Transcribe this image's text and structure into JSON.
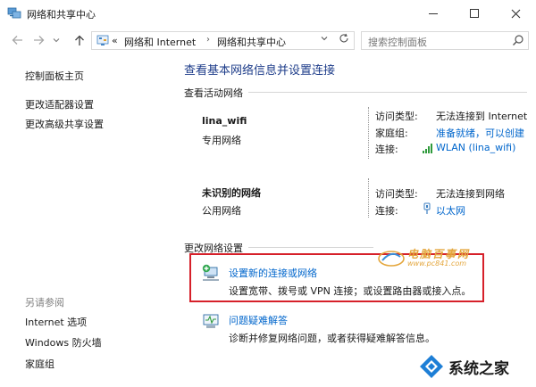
{
  "window": {
    "title": "网络和共享中心"
  },
  "address_bar": {
    "overflow": "«",
    "crumbs": [
      "网络和 Internet",
      "网络和共享中心"
    ],
    "chevron": "›"
  },
  "search": {
    "placeholder": "搜索控制面板"
  },
  "sidebar": {
    "links": [
      "控制面板主页",
      "更改适配器设置",
      "更改高级共享设置"
    ],
    "see_also_header": "另请参阅",
    "see_also": [
      "Internet 选项",
      "Windows 防火墙",
      "家庭组"
    ]
  },
  "main": {
    "title": "查看基本网络信息并设置连接",
    "active_networks_label": "查看活动网络",
    "networks": [
      {
        "name": "lina_wifi",
        "type": "专用网络",
        "rows": [
          {
            "key": "访问类型:",
            "value": "无法连接到 Internet",
            "link": false
          },
          {
            "key": "家庭组:",
            "value": "准备就绪，可以创建",
            "link": true
          },
          {
            "key": "连接:",
            "value": "WLAN (lina_wifi)",
            "link": true,
            "icon": "wifi-signal-icon"
          }
        ]
      },
      {
        "name": "未识别的网络",
        "type": "公用网络",
        "rows": [
          {
            "key": "访问类型:",
            "value": "无法连接到网络",
            "link": false
          },
          {
            "key": "连接:",
            "value": "以太网",
            "link": true,
            "icon": "ethernet-icon"
          }
        ]
      }
    ],
    "change_settings_label": "更改网络设置",
    "tasks": [
      {
        "title": "设置新的连接或网络",
        "desc": "设置宽带、拨号或 VPN 连接；或设置路由器或接入点。",
        "icon": "new-connection-icon"
      },
      {
        "title": "问题疑难解答",
        "desc": "诊断并修复网络问题，或者获得疑难解答信息。",
        "icon": "troubleshoot-icon"
      }
    ]
  },
  "watermarks": {
    "top_main": "电脑百事网",
    "top_sub": "www.pc841.com",
    "bottom_text": "系统之家"
  },
  "colors": {
    "link": "#0066cc",
    "title": "#1e3d8a",
    "highlight": "#d6202a"
  }
}
